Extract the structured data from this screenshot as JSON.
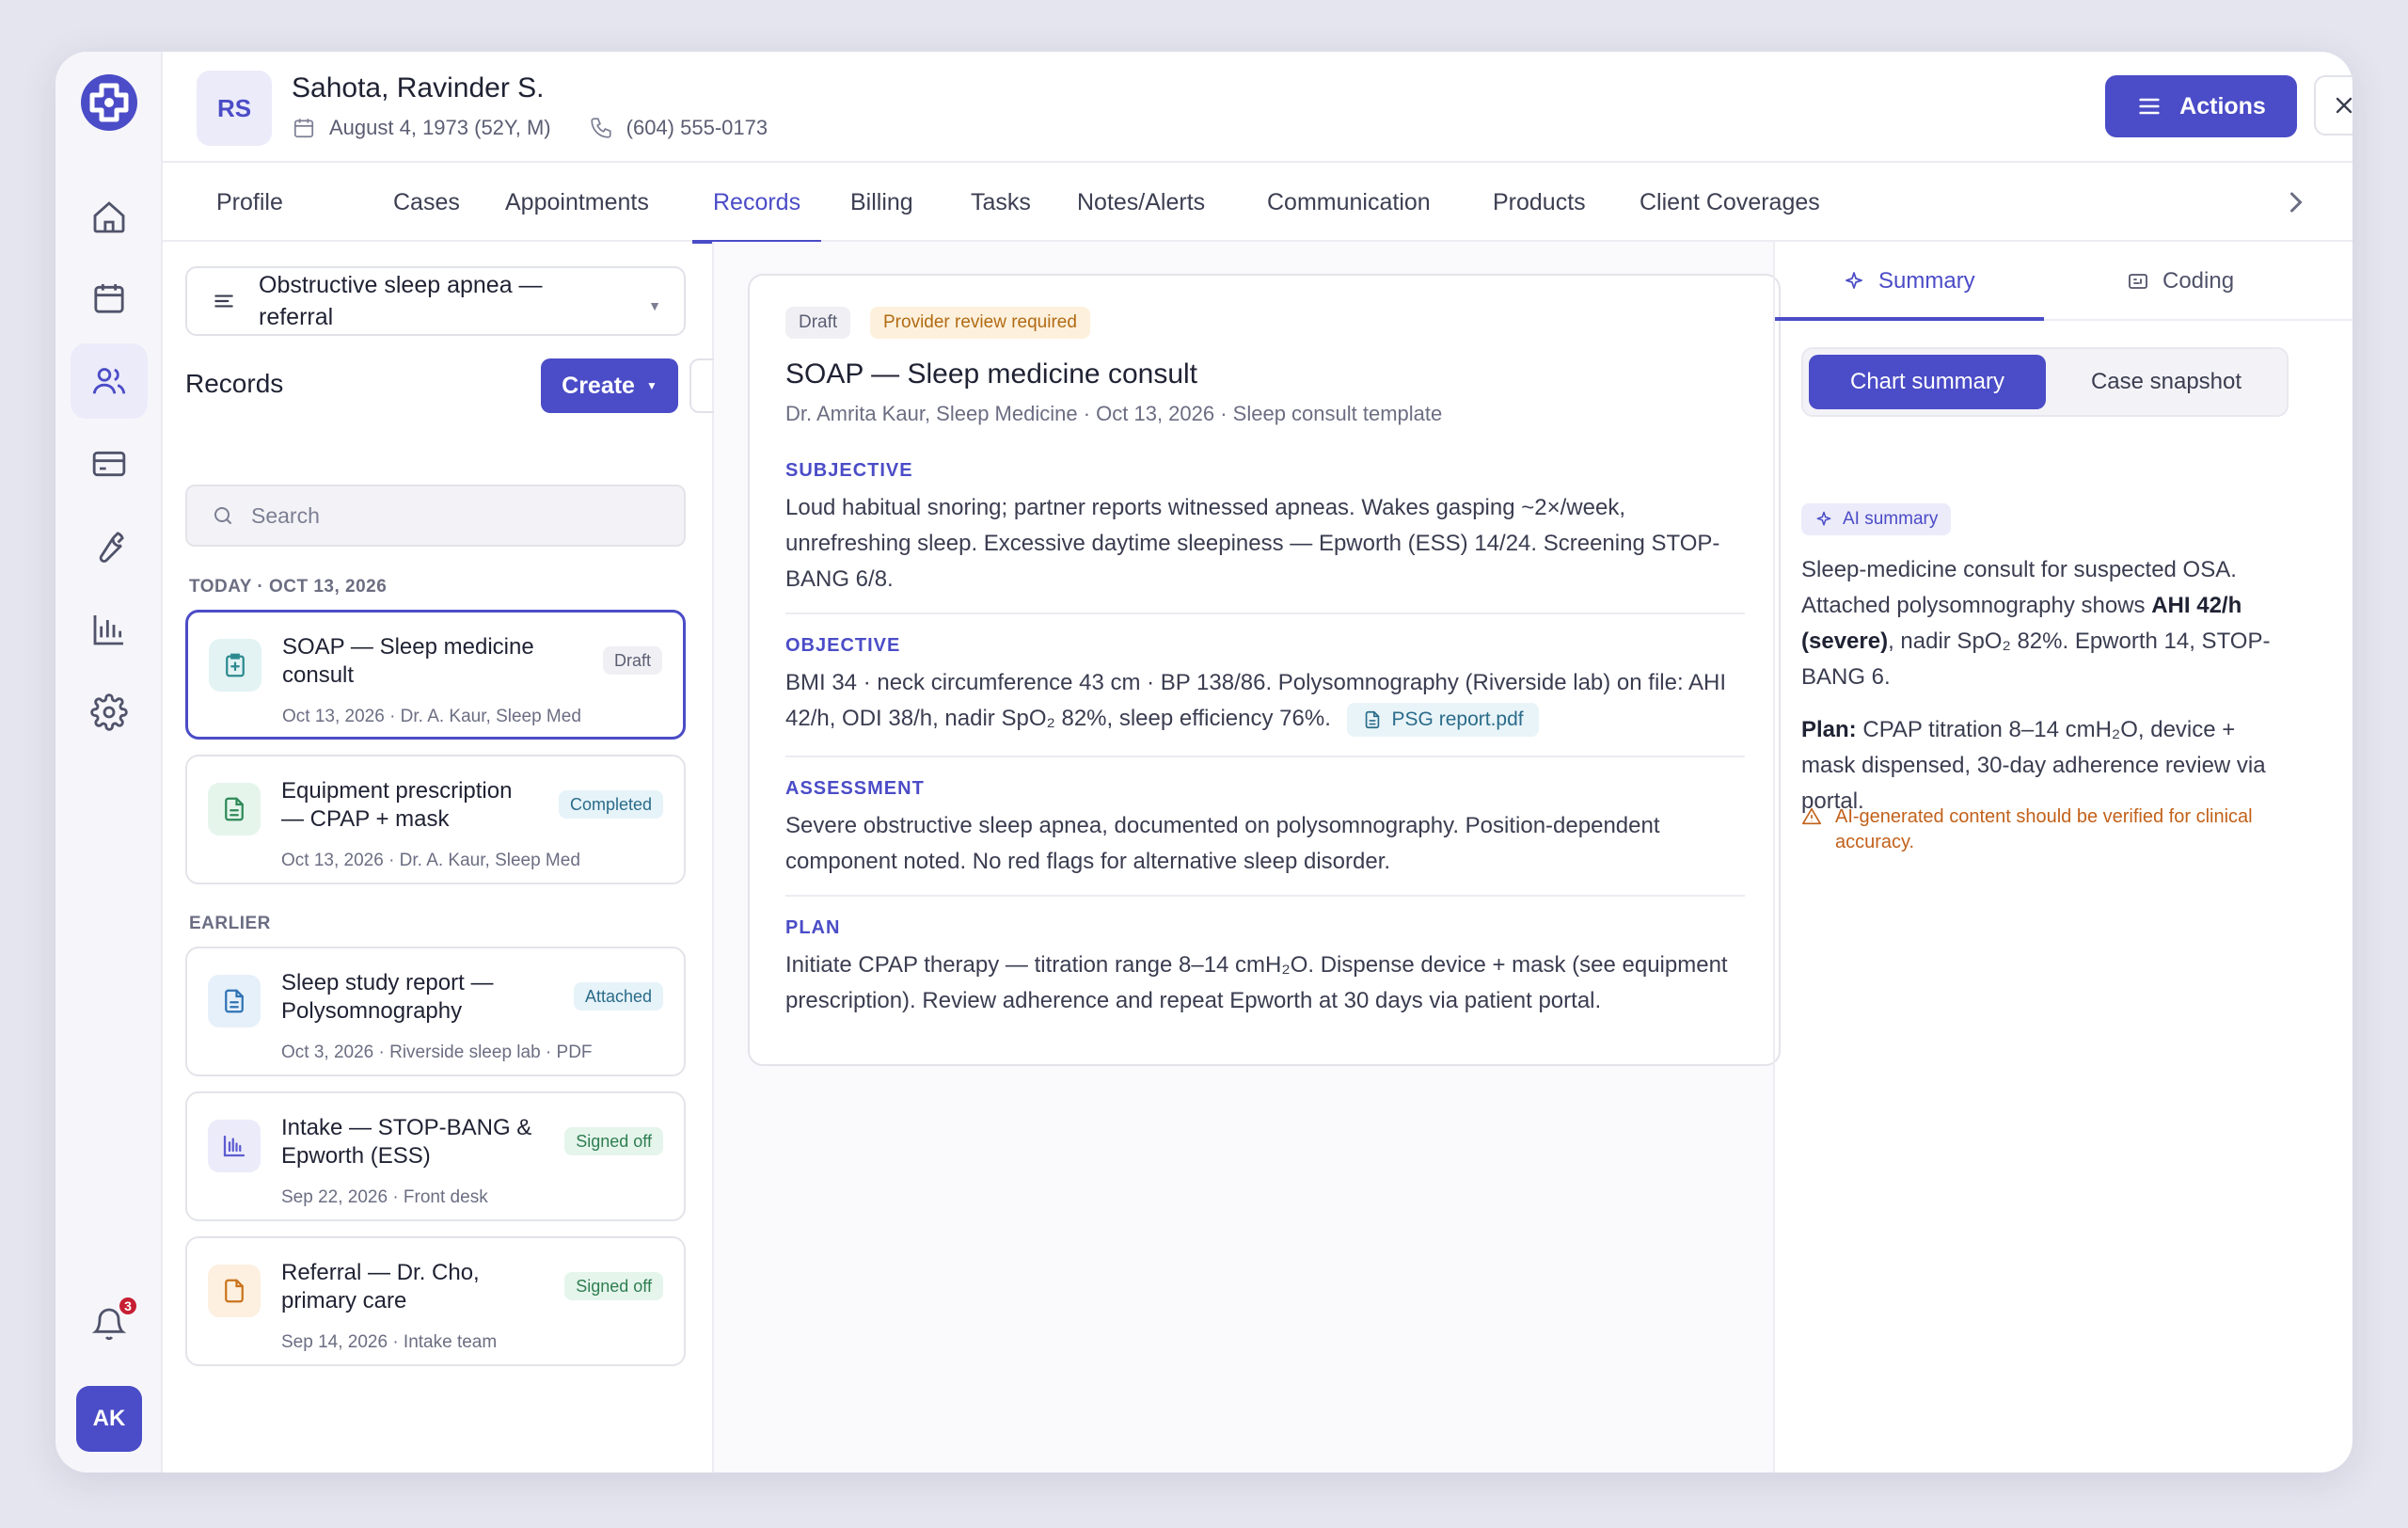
{
  "rail": {
    "avatar_initials": "AK",
    "notifications_count": "3"
  },
  "patient": {
    "initials": "RS",
    "name": "Sahota, Ravinder S.",
    "dob": "August 4, 1973 (52Y, M)",
    "phone": "(604) 555-0173"
  },
  "header": {
    "actions_label": "Actions"
  },
  "tabs": [
    {
      "label": "Profile"
    },
    {
      "label": "Cases"
    },
    {
      "label": "Appointments"
    },
    {
      "label": "Records"
    },
    {
      "label": "Billing"
    },
    {
      "label": "Tasks"
    },
    {
      "label": "Notes/Alerts"
    },
    {
      "label": "Communication"
    },
    {
      "label": "Products"
    },
    {
      "label": "Client Coverages"
    }
  ],
  "records": {
    "case_selector": "Obstructive sleep apnea — referral",
    "title": "Records",
    "create_label": "Create",
    "search_placeholder": "Search",
    "group_today": "TODAY · OCT 13, 2026",
    "group_earlier": "EARLIER",
    "items": [
      {
        "title": "SOAP — Sleep medicine consult",
        "meta": "Oct 13, 2026 · Dr. A. Kaur, Sleep Med",
        "badge": "Draft",
        "icon": "clipboard-plus-icon"
      },
      {
        "title": "Equipment prescription — CPAP + mask",
        "meta": "Oct 13, 2026 · Dr. A. Kaur, Sleep Med",
        "badge": "Completed",
        "icon": "document-icon"
      },
      {
        "title": "Sleep study report — Polysomnography",
        "meta": "Oct 3, 2026 · Riverside sleep lab · PDF",
        "badge": "Attached",
        "icon": "document-icon"
      },
      {
        "title": "Intake — STOP-BANG & Epworth (ESS)",
        "meta": "Sep 22, 2026 · Front desk",
        "badge": "Signed off",
        "icon": "bar-chart-icon"
      },
      {
        "title": "Referral — Dr. Cho, primary care",
        "meta": "Sep 14, 2026 · Intake team",
        "badge": "Signed off",
        "icon": "file-icon"
      }
    ]
  },
  "document": {
    "status": "Draft",
    "review_flag": "Provider review required",
    "title": "SOAP — Sleep medicine consult",
    "subtitle": "Dr. Amrita Kaur, Sleep Medicine · Oct 13, 2026 · Sleep consult template",
    "sections": [
      {
        "heading": "SUBJECTIVE",
        "body": "Loud habitual snoring; partner reports witnessed apneas. Wakes gasping ~2×/week, unrefreshing sleep. Excessive daytime sleepiness — Epworth (ESS) 14/24. Screening STOP-BANG 6/8."
      },
      {
        "heading": "OBJECTIVE",
        "body": "BMI 34 · neck circumference 43 cm · BP 138/86. Polysomnography (Riverside lab) on file: AHI 42/h, ODI 38/h, nadir SpO₂ 82%, sleep efficiency 76%."
      },
      {
        "heading": "ASSESSMENT",
        "body": "Severe obstructive sleep apnea, documented on polysomnography. Position-dependent component noted. No red flags for alternative sleep disorder."
      },
      {
        "heading": "PLAN",
        "body": "Initiate CPAP therapy — titration range 8–14 cmH₂O. Dispense device + mask (see equipment prescription). Review adherence and repeat Epworth at 30 days via patient portal."
      }
    ],
    "attachment": "PSG report.pdf"
  },
  "side": {
    "tab_summary": "Summary",
    "tab_coding": "Coding",
    "seg_chart": "Chart summary",
    "seg_case": "Case snapshot",
    "ai_label": "AI summary",
    "summary_pre": "Sleep-medicine consult for suspected OSA. Attached polysomnography shows ",
    "summary_bold": "AHI 42/h (severe)",
    "summary_post": ", nadir SpO₂ 82%. Epworth 14, STOP-BANG 6.",
    "plan_label": "Plan:",
    "plan_text": " CPAP titration 8–14 cmH₂O, device + mask dispensed, 30-day adherence review via portal.",
    "warning": "AI-generated content should be verified for clinical accuracy."
  },
  "colors": {
    "accent": "#4b4cc7",
    "warning": "#c2611a",
    "badge_signed": "#2e7d4f",
    "badge_info": "#2a6b8a"
  }
}
